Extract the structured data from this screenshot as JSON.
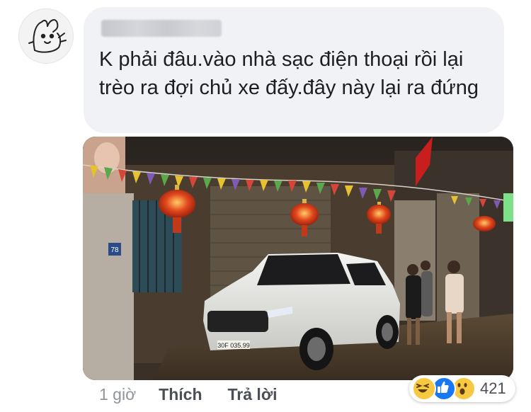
{
  "author": {
    "name_display": "blurred"
  },
  "comment": {
    "text": "K phải đâu.vào nhà sạc điện thoại rồi lại trèo ra đợi chủ xe đấy.đây này lại ra đứng"
  },
  "photo": {
    "house_number": "78",
    "license_plate": "30F 035.99"
  },
  "actions": {
    "time": "1 giờ",
    "like": "Thích",
    "reply": "Trả lời"
  },
  "reactions": {
    "icons": [
      "haha-icon",
      "like-icon",
      "wow-icon"
    ],
    "count": "421"
  },
  "colors": {
    "bubble": "#f1f2f6",
    "like_blue": "#1877f2",
    "reaction_yellow": "#f7c842"
  }
}
